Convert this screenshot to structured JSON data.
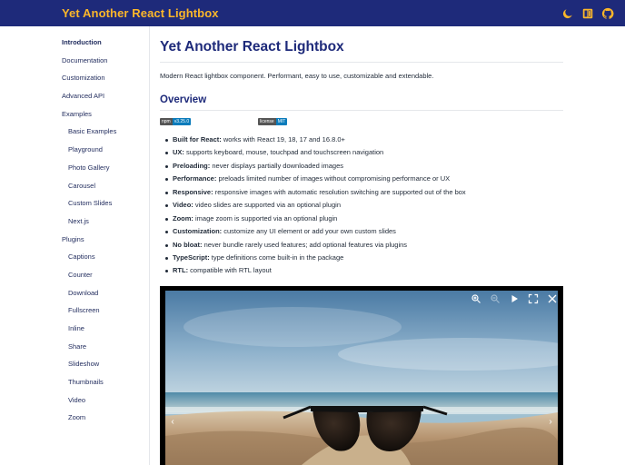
{
  "header": {
    "title": "Yet Another React Lightbox",
    "icons": [
      "moon-icon",
      "book-icon",
      "github-icon"
    ],
    "bg_color": "#1e2a7a",
    "title_color": "#fcb72a"
  },
  "sidebar": {
    "items": [
      {
        "label": "Introduction",
        "level": 0,
        "active": true
      },
      {
        "label": "Documentation",
        "level": 0
      },
      {
        "label": "Customization",
        "level": 0
      },
      {
        "label": "Advanced API",
        "level": 0
      },
      {
        "label": "Examples",
        "level": 0
      },
      {
        "label": "Basic Examples",
        "level": 1
      },
      {
        "label": "Playground",
        "level": 1
      },
      {
        "label": "Photo Gallery",
        "level": 1
      },
      {
        "label": "Carousel",
        "level": 1
      },
      {
        "label": "Custom Slides",
        "level": 1
      },
      {
        "label": "Next.js",
        "level": 1
      },
      {
        "label": "Plugins",
        "level": 0
      },
      {
        "label": "Captions",
        "level": 1
      },
      {
        "label": "Counter",
        "level": 1
      },
      {
        "label": "Download",
        "level": 1
      },
      {
        "label": "Fullscreen",
        "level": 1
      },
      {
        "label": "Inline",
        "level": 1
      },
      {
        "label": "Share",
        "level": 1
      },
      {
        "label": "Slideshow",
        "level": 1
      },
      {
        "label": "Thumbnails",
        "level": 1
      },
      {
        "label": "Video",
        "level": 1
      },
      {
        "label": "Zoom",
        "level": 1
      }
    ]
  },
  "main": {
    "title": "Yet Another React Lightbox",
    "intro": "Modern React lightbox component. Performant, easy to use, customizable and extendable.",
    "overview_title": "Overview",
    "badges": [
      {
        "key": "npm",
        "value": "v3.25.0"
      },
      {
        "key": "license",
        "value": "MIT"
      }
    ],
    "features": [
      {
        "term": "Built for React:",
        "text": " works with React 19, 18, 17 and 16.8.0+"
      },
      {
        "term": "UX:",
        "text": " supports keyboard, mouse, touchpad and touchscreen navigation"
      },
      {
        "term": "Preloading:",
        "text": " never displays partially downloaded images"
      },
      {
        "term": "Performance:",
        "text": " preloads limited number of images without compromising performance or UX"
      },
      {
        "term": "Responsive:",
        "text": " responsive images with automatic resolution switching are supported out of the box"
      },
      {
        "term": "Video:",
        "text": " video slides are supported via an optional plugin"
      },
      {
        "term": "Zoom:",
        "text": " image zoom is supported via an optional plugin"
      },
      {
        "term": "Customization:",
        "text": " customize any UI element or add your own custom slides"
      },
      {
        "term": "No bloat:",
        "text": " never bundle rarely used features; add optional features via plugins"
      },
      {
        "term": "TypeScript:",
        "text": " type definitions come built-in in the package"
      },
      {
        "term": "RTL:",
        "text": " compatible with RTL layout"
      }
    ]
  },
  "lightbox": {
    "toolbar_icons": [
      "zoom-in-icon",
      "zoom-out-icon",
      "play-icon",
      "fullscreen-icon",
      "close-icon"
    ],
    "prev_glyph": "‹",
    "next_glyph": "›"
  }
}
